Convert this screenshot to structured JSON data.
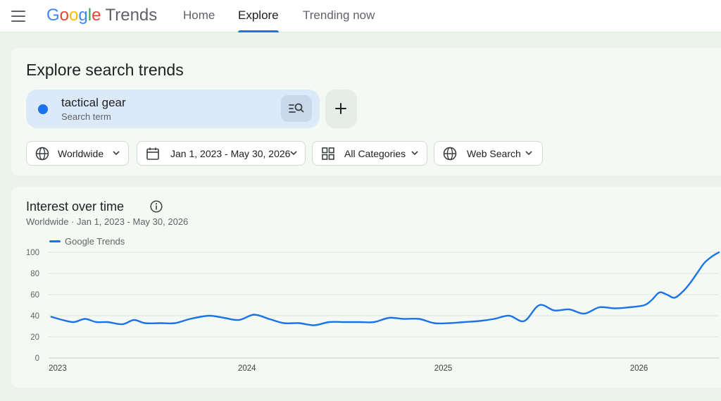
{
  "header": {
    "logo": {
      "letters": [
        "G",
        "o",
        "o",
        "g",
        "l",
        "e"
      ],
      "colors": [
        "#4285f4",
        "#ea4335",
        "#fbbc05",
        "#4285f4",
        "#34a853",
        "#ea4335"
      ],
      "product": "Trends"
    },
    "tabs": [
      {
        "label": "Home",
        "active": false
      },
      {
        "label": "Explore",
        "active": true
      },
      {
        "label": "Trending now",
        "active": false
      }
    ]
  },
  "explore": {
    "title": "Explore search trends",
    "term": {
      "value": "tactical gear",
      "label": "Search term",
      "color": "#1a73e8"
    },
    "filters": {
      "region": "Worldwide",
      "date_range": "Jan 1, 2023 - May 30, 2026",
      "category": "All Categories",
      "property": "Web Search"
    }
  },
  "interest": {
    "title": "Interest over time",
    "subtitle": "Worldwide · Jan 1, 2023 - May 30, 2026",
    "legend": "Google Trends"
  },
  "chart_data": {
    "type": "line",
    "ylim": [
      0,
      100
    ],
    "yticks": [
      "100",
      "80",
      "60",
      "40",
      "20",
      "0"
    ],
    "xticks": [
      "2023",
      "2024",
      "2025",
      "2026"
    ],
    "grid": true,
    "color": "#1a73e8",
    "series": [
      {
        "name": "Google Trends",
        "x": [
          "2023-01-01",
          "2023-01-22",
          "2023-02-12",
          "2023-03-05",
          "2023-03-26",
          "2023-04-16",
          "2023-05-14",
          "2023-06-04",
          "2023-06-25",
          "2023-07-23",
          "2023-08-20",
          "2023-09-17",
          "2023-10-22",
          "2023-11-19",
          "2023-12-17",
          "2024-01-14",
          "2024-02-11",
          "2024-03-10",
          "2024-04-07",
          "2024-05-05",
          "2024-06-02",
          "2024-06-30",
          "2024-07-28",
          "2024-08-25",
          "2024-09-22",
          "2024-10-20",
          "2024-11-17",
          "2024-12-15",
          "2025-01-12",
          "2025-02-09",
          "2025-03-09",
          "2025-04-06",
          "2025-05-04",
          "2025-06-01",
          "2025-06-29",
          "2025-07-27",
          "2025-08-24",
          "2025-09-21",
          "2025-10-19",
          "2025-11-16",
          "2025-12-14",
          "2026-01-11",
          "2026-01-25",
          "2026-02-08",
          "2026-02-22",
          "2026-03-08",
          "2026-03-22",
          "2026-04-05",
          "2026-04-19",
          "2026-05-03",
          "2026-05-17",
          "2026-05-30"
        ],
        "values": [
          39,
          36,
          34,
          37,
          34,
          34,
          32,
          36,
          33,
          33,
          33,
          37,
          40,
          38,
          36,
          41,
          37,
          33,
          33,
          31,
          34,
          34,
          34,
          34,
          38,
          37,
          37,
          33,
          33,
          34,
          35,
          37,
          40,
          35,
          50,
          45,
          46,
          42,
          48,
          47,
          48,
          50,
          55,
          62,
          60,
          57,
          62,
          70,
          80,
          90,
          96,
          100
        ]
      }
    ]
  }
}
